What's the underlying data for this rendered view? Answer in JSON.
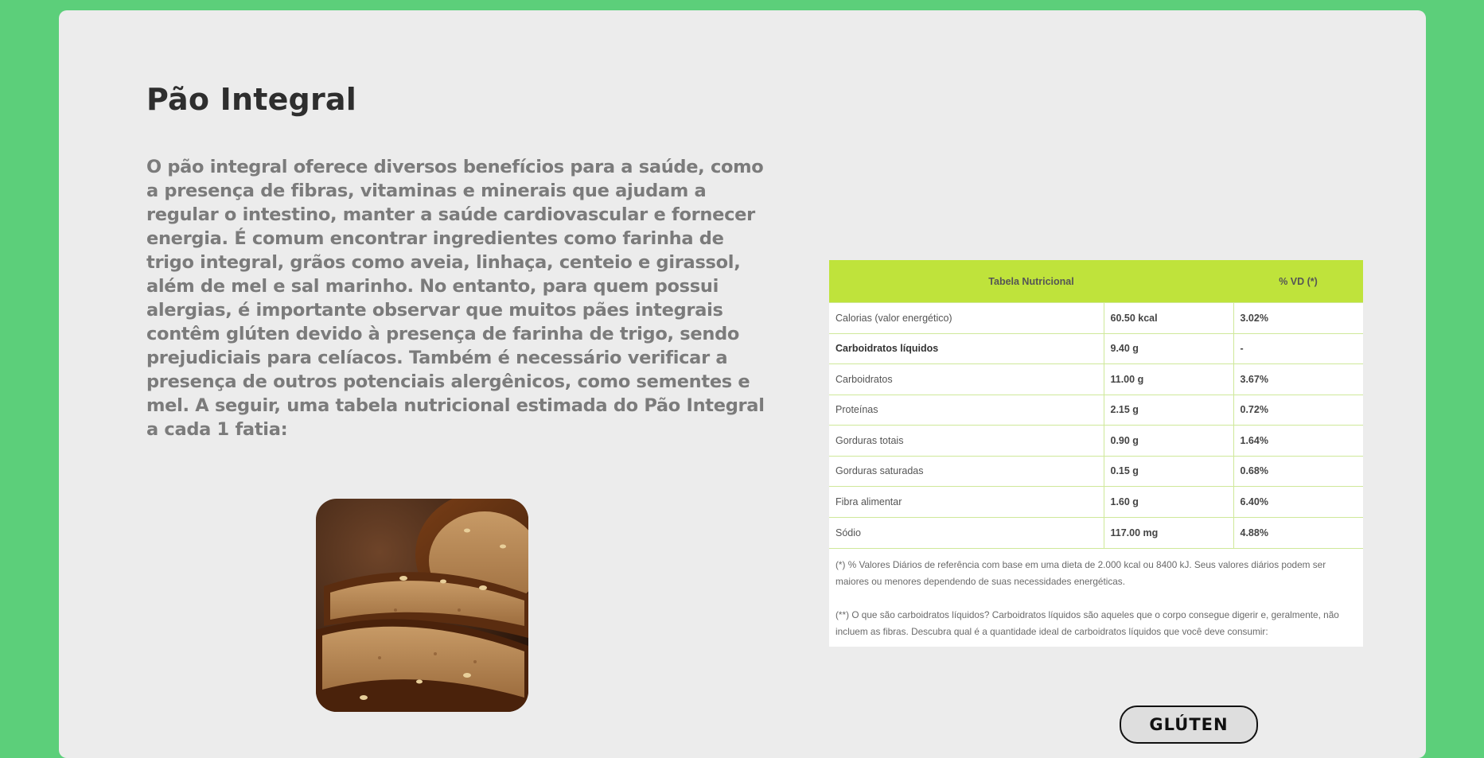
{
  "product": {
    "title": "Pão Integral",
    "description": "O pão integral oferece diversos benefícios para a saúde, como a presença de fibras, vitaminas e minerais que ajudam a regular o intestino, manter a saúde cardiovascular e fornecer energia. É comum encontrar ingredientes como farinha de trigo integral, grãos como aveia, linhaça, centeio e girassol, além de mel e sal marinho. No entanto, para quem possui alergias, é importante observar que muitos pães integrais contêm glúten devido à presença de farinha de trigo, sendo prejudiciais para celíacos. Também é necessário verificar a presença de outros potenciais alergênicos, como sementes e mel. A seguir, uma tabela nutricional estimada do Pão Integral a cada 1 fatia:"
  },
  "nutrition_table": {
    "header_title": "Tabela Nutricional",
    "header_vd": "% VD (*)",
    "rows": [
      {
        "name": "Calorias (valor energético)",
        "amount": "60.50 kcal",
        "vd": "3.02%"
      },
      {
        "name": "Carboidratos líquidos",
        "amount": "9.40 g",
        "vd": "-"
      },
      {
        "name": "Carboidratos",
        "amount": "11.00 g",
        "vd": "3.67%"
      },
      {
        "name": "Proteínas",
        "amount": "2.15 g",
        "vd": "0.72%"
      },
      {
        "name": "Gorduras totais",
        "amount": "0.90 g",
        "vd": "1.64%"
      },
      {
        "name": "Gorduras saturadas",
        "amount": "0.15 g",
        "vd": "0.68%"
      },
      {
        "name": "Fibra alimentar",
        "amount": "1.60 g",
        "vd": "6.40%"
      },
      {
        "name": "Sódio",
        "amount": "117.00 mg",
        "vd": "4.88%"
      }
    ],
    "note_1": "(*) % Valores Diários de referência com base em uma dieta de 2.000 kcal ou 8400 kJ. Seus valores diários podem ser maiores ou menores dependendo de suas necessidades energéticas.",
    "note_2": "(**) O que são carboidratos líquidos? Carboidratos líquidos são aqueles que o corpo consegue digerir e, geralmente, não incluem as fibras. Descubra qual é a quantidade ideal de carboidratos líquidos que você deve consumir:"
  },
  "gluten_button": {
    "label": "GLÚTEN"
  },
  "colors": {
    "page_background": "#5ccf7a",
    "card_background": "#ececec",
    "table_header": "#bfe33b",
    "table_border": "#cfe89a"
  }
}
